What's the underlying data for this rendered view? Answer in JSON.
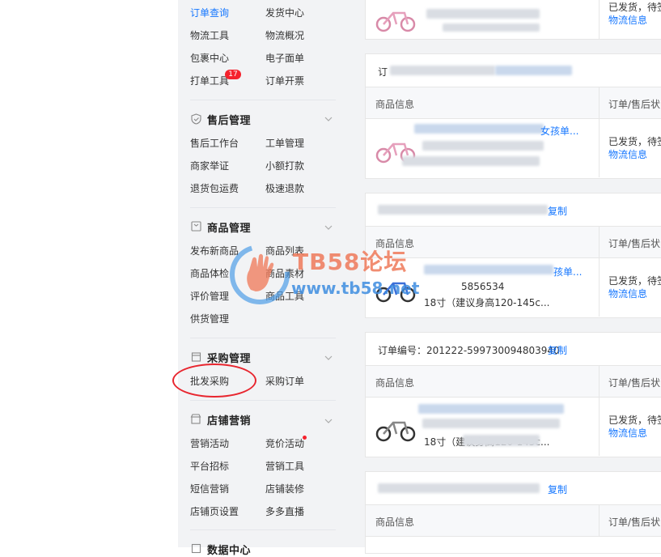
{
  "sidebar": {
    "logistics": {
      "items": [
        {
          "label": "订单查询",
          "active": true
        },
        {
          "label": "发货中心"
        },
        {
          "label": "物流工具"
        },
        {
          "label": "物流概况"
        },
        {
          "label": "包裹中心"
        },
        {
          "label": "电子面单"
        },
        {
          "label": "打单工具",
          "badge": "17"
        },
        {
          "label": "订单开票"
        }
      ]
    },
    "after_sales": {
      "title": "售后管理",
      "icon": "shield-icon",
      "items": [
        "售后工作台",
        "工单管理",
        "商家举证",
        "小额打款",
        "退货包运费",
        "极速退款"
      ]
    },
    "goods": {
      "title": "商品管理",
      "icon": "goods-box-icon",
      "items": [
        "发布新商品",
        "商品列表",
        "商品体检",
        "商品素材",
        "评价管理",
        "商品工具",
        "供货管理"
      ]
    },
    "purchase": {
      "title": "采购管理",
      "icon": "purchase-icon",
      "items": [
        "批发采购",
        "采购订单"
      ]
    },
    "marketing": {
      "title": "店铺营销",
      "icon": "shop-icon",
      "items": [
        "营销活动",
        "竞价活动",
        "平台招标",
        "营销工具",
        "短信营销",
        "店铺装修",
        "店铺页设置",
        "多多直播"
      ]
    },
    "data": {
      "title": "数据中心"
    }
  },
  "orders": {
    "col_product": "商品信息",
    "col_status": "订单/售后状",
    "status_line": "已发货，待签",
    "logistics_link": "物流信息",
    "copy_label": "复制",
    "order_prefix": "订",
    "order_label": "订单编号：",
    "order_number": "201222-599730094803940",
    "card2_title_suffix": "女孩单...",
    "card3_title_suffix": "孩单...",
    "card3_id_tail": "5856534",
    "card3_spec": "18寸（建议身高120-145c...",
    "card4_spec": "18寸（建议身高120-145c..."
  },
  "watermark": {
    "title": "TB58论坛",
    "url": "www.tb58.net"
  },
  "colors": {
    "accent": "#1677ff",
    "badge": "#f5222d",
    "annotation": "#e8262f"
  }
}
